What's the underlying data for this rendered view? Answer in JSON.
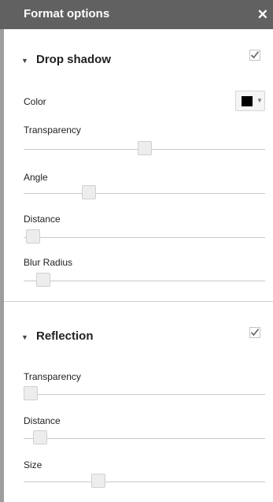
{
  "header": {
    "title": "Format options",
    "close_glyph": "✕"
  },
  "drop_shadow": {
    "title": "Drop shadow",
    "expanded": true,
    "enabled": true,
    "color_label": "Color",
    "color_value": "#000000",
    "sliders": [
      {
        "label": "Transparency",
        "value": 0.5
      },
      {
        "label": "Angle",
        "value": 0.27
      },
      {
        "label": "Distance",
        "value": 0.04
      },
      {
        "label": "Blur Radius",
        "value": 0.08
      }
    ]
  },
  "reflection": {
    "title": "Reflection",
    "expanded": true,
    "enabled": true,
    "sliders": [
      {
        "label": "Transparency",
        "value": 0.03
      },
      {
        "label": "Distance",
        "value": 0.07
      },
      {
        "label": "Size",
        "value": 0.31
      }
    ]
  }
}
